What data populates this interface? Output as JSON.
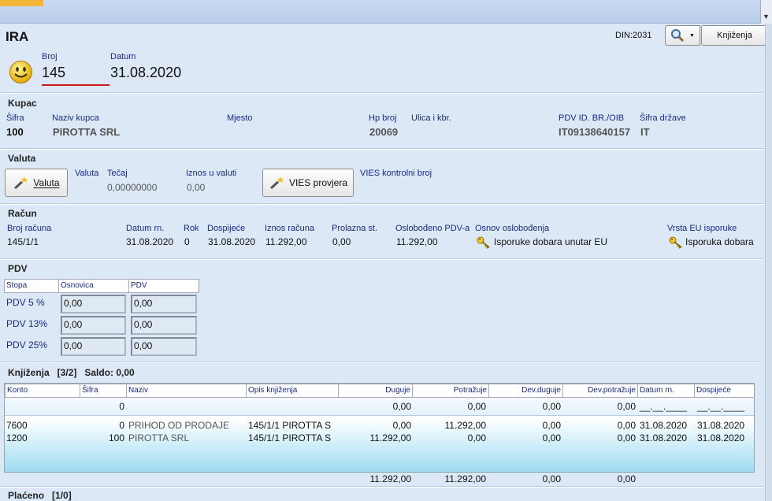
{
  "title": "IRA",
  "din": "DIN:2031",
  "book_button": "Knjiženja",
  "broj": {
    "label": "Broj",
    "value": "145"
  },
  "datum": {
    "label": "Datum",
    "value": "31.08.2020"
  },
  "kupac": {
    "section": "Kupac",
    "sifra_label": "Šifra",
    "sifra": "100",
    "naziv_label": "Naziv kupca",
    "naziv": "PIROTTA SRL",
    "mjesto_label": "Mjesto",
    "hp_label": "Hp broj",
    "hp": "20069",
    "ulica_label": "Ulica i kbr.",
    "pdv_label": "PDV ID. BR./OIB",
    "pdv": "IT09138640157",
    "drzava_label": "Šifra države",
    "drzava": "IT"
  },
  "valuta": {
    "section": "Valuta",
    "button": "Valuta",
    "valuta_label": "Valuta",
    "tecaj_label": "Tečaj",
    "tecaj": "0,00000000",
    "iznos_label": "Iznos u valuti",
    "iznos": "0,00",
    "vies_button": "VIES provjera",
    "vies_label": "VIES kontrolni broj"
  },
  "racun": {
    "section": "Račun",
    "broj_label": "Broj računa",
    "broj": "145/1/1",
    "datum_label": "Datum rn.",
    "datum": "31.08.2020",
    "rok_label": "Rok",
    "rok": "0",
    "dospijece_label": "Dospijeće",
    "dospijece": "31.08.2020",
    "iznos_label": "Iznos računa",
    "iznos": "11.292,00",
    "prolazna_label": "Prolazna st.",
    "prolazna": "0,00",
    "oslobodeno_label": "Oslobođeno PDV-a",
    "oslobodeno": "11.292,00",
    "osnov_label": "Osnov oslobođenja",
    "osnov": "Isporuke dobara unutar EU",
    "vrsta_label": "Vrsta EU isporuke",
    "vrsta": "Isporuka dobara"
  },
  "pdv": {
    "section": "PDV",
    "headers": [
      "Stopa",
      "Osnovica",
      "PDV"
    ],
    "rows": [
      {
        "stopa": "PDV 5 %",
        "osnovica": "0,00",
        "pdv": "0,00"
      },
      {
        "stopa": "PDV 13%",
        "osnovica": "0,00",
        "pdv": "0,00"
      },
      {
        "stopa": "PDV 25%",
        "osnovica": "0,00",
        "pdv": "0,00"
      }
    ]
  },
  "knjizenja": {
    "section": "Knjiženja   [3/2]   Saldo: 0,00",
    "headers": [
      "Konto",
      "Šifra",
      "Naziv",
      "Opis knjiženja",
      "Duguje",
      "Potražuje",
      "Dev.duguje",
      "Dev.potražuje",
      "Datum rn.",
      "Dospijeće"
    ],
    "rows": [
      [
        "",
        "0",
        "",
        "",
        "0,00",
        "0,00",
        "0,00",
        "0,00",
        "__.__.____",
        "__.__.____"
      ],
      [
        "7600",
        "0",
        "PRIHOD OD PRODAJE",
        "145/1/1 PIROTTA S",
        "0,00",
        "11.292,00",
        "0,00",
        "0,00",
        "31.08.2020",
        "31.08.2020"
      ],
      [
        "1200",
        "100",
        "PIROTTA SRL",
        "145/1/1 PIROTTA S",
        "11.292,00",
        "0,00",
        "0,00",
        "0,00",
        "31.08.2020",
        "31.08.2020"
      ]
    ],
    "totals": [
      "11.292,00",
      "11.292,00",
      "0,00",
      "0,00"
    ]
  },
  "placeno": {
    "section": "Plaćeno   [1/0]"
  }
}
